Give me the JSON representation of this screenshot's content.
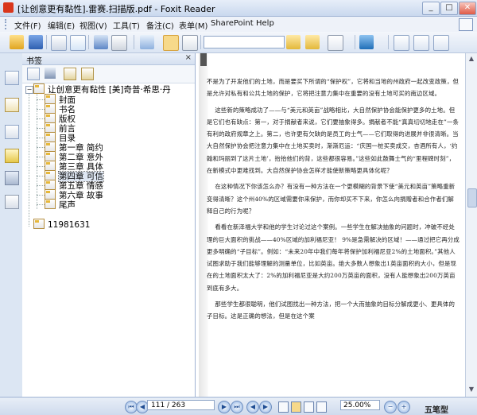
{
  "window": {
    "title": "[让创意更有黏性].雷赛.扫描版.pdf - Foxit Reader",
    "minimize": "_",
    "maximize": "□",
    "close": "✕"
  },
  "menu": [
    "文件(F)",
    "编辑(E)",
    "视图(V)",
    "工具(T)",
    "备注(C)",
    "表单(M)",
    "SharePoint",
    "Help"
  ],
  "panel": {
    "title": "书签",
    "close": "×"
  },
  "tree": {
    "root": "让创意更有黏性 [美]奇普·希思·丹",
    "children": [
      "封面",
      "书名",
      "版权",
      "前言",
      "目录",
      "第一章  简约",
      "第二章  意外",
      "第三章  具体",
      "第四章  可信",
      "第五章  情感",
      "第六章  故事",
      "尾声"
    ],
    "selected_index": 8,
    "extra": "11981631"
  },
  "page": {
    "paragraphs": [
      "不是为了开发他们的土地，而是要买下所谓的“保护权”，它将和当地的州政府一起改变政策，但是允许对私有和公共土地的保护，它将把注意力集中在重要的没有土地可买的南边区域。",
      "这些新的策略成功了——与“美元和英亩”战略相比，大自然保护协会能保护更多的土地。但是它们也有缺点：第一，对于捐献者来说，它们要抽象得多。捐献者不能“真真切切地走在”一条有利的政府规章之上。第二，也许更有欠缺的是员工的士气——它们取得的进展并非很清晰。当大自然保护协会把注意力集中在土地买卖时，渐渐厄运：“庆国一桩买卖成交，杏酒所有人，‘约翰和玛丽到了这片土地’，抬抬他们的背，这些都很容易。”这些如此鼓舞士气的“里程碑时刻”，在新模式中更难找到。大自然保护协会怎样才能使新策略更具体化呢？",
      "在这种情况下你该怎么办？有没有一种方法在一个更模糊的背景下使“美元和英亩”策略重新变得清晰？这个州40%的区域需要你来保护，而你却买不下来，你怎么向捐赠者和合作者们解释自己的行为呢？",
      "看看在新泽福大学和他的学生讨论过这个案例。一些学生在解决抽象的问题时，冲破不经处理的巨大面积的挑战——40%区域的加利福尼亚！ 9%是急需解决的区域！——通过把它再分成更多明确的“子目标”。例如：“未来20年中我们每年将保护加利福尼亚2%的土地面积。”其他人试图求助于我们能够理解的测量单位，比如英亩。绝大多数人想象出1英亩面积的大小，但是现在的土地面积太大了：2%的加利福尼亚是大约200万英亩的面积，没有人能想象出200万英亩到底有多大。",
      "那些学生都很聪明，他们试图找出一种方法，把一个大而抽象的目标分解成更小、更具体的子目标。这是正确的想法，但是在这个案"
    ]
  },
  "status": {
    "page_display": "111 / 263",
    "zoom": "25.00%",
    "watermark": "五笔型"
  }
}
